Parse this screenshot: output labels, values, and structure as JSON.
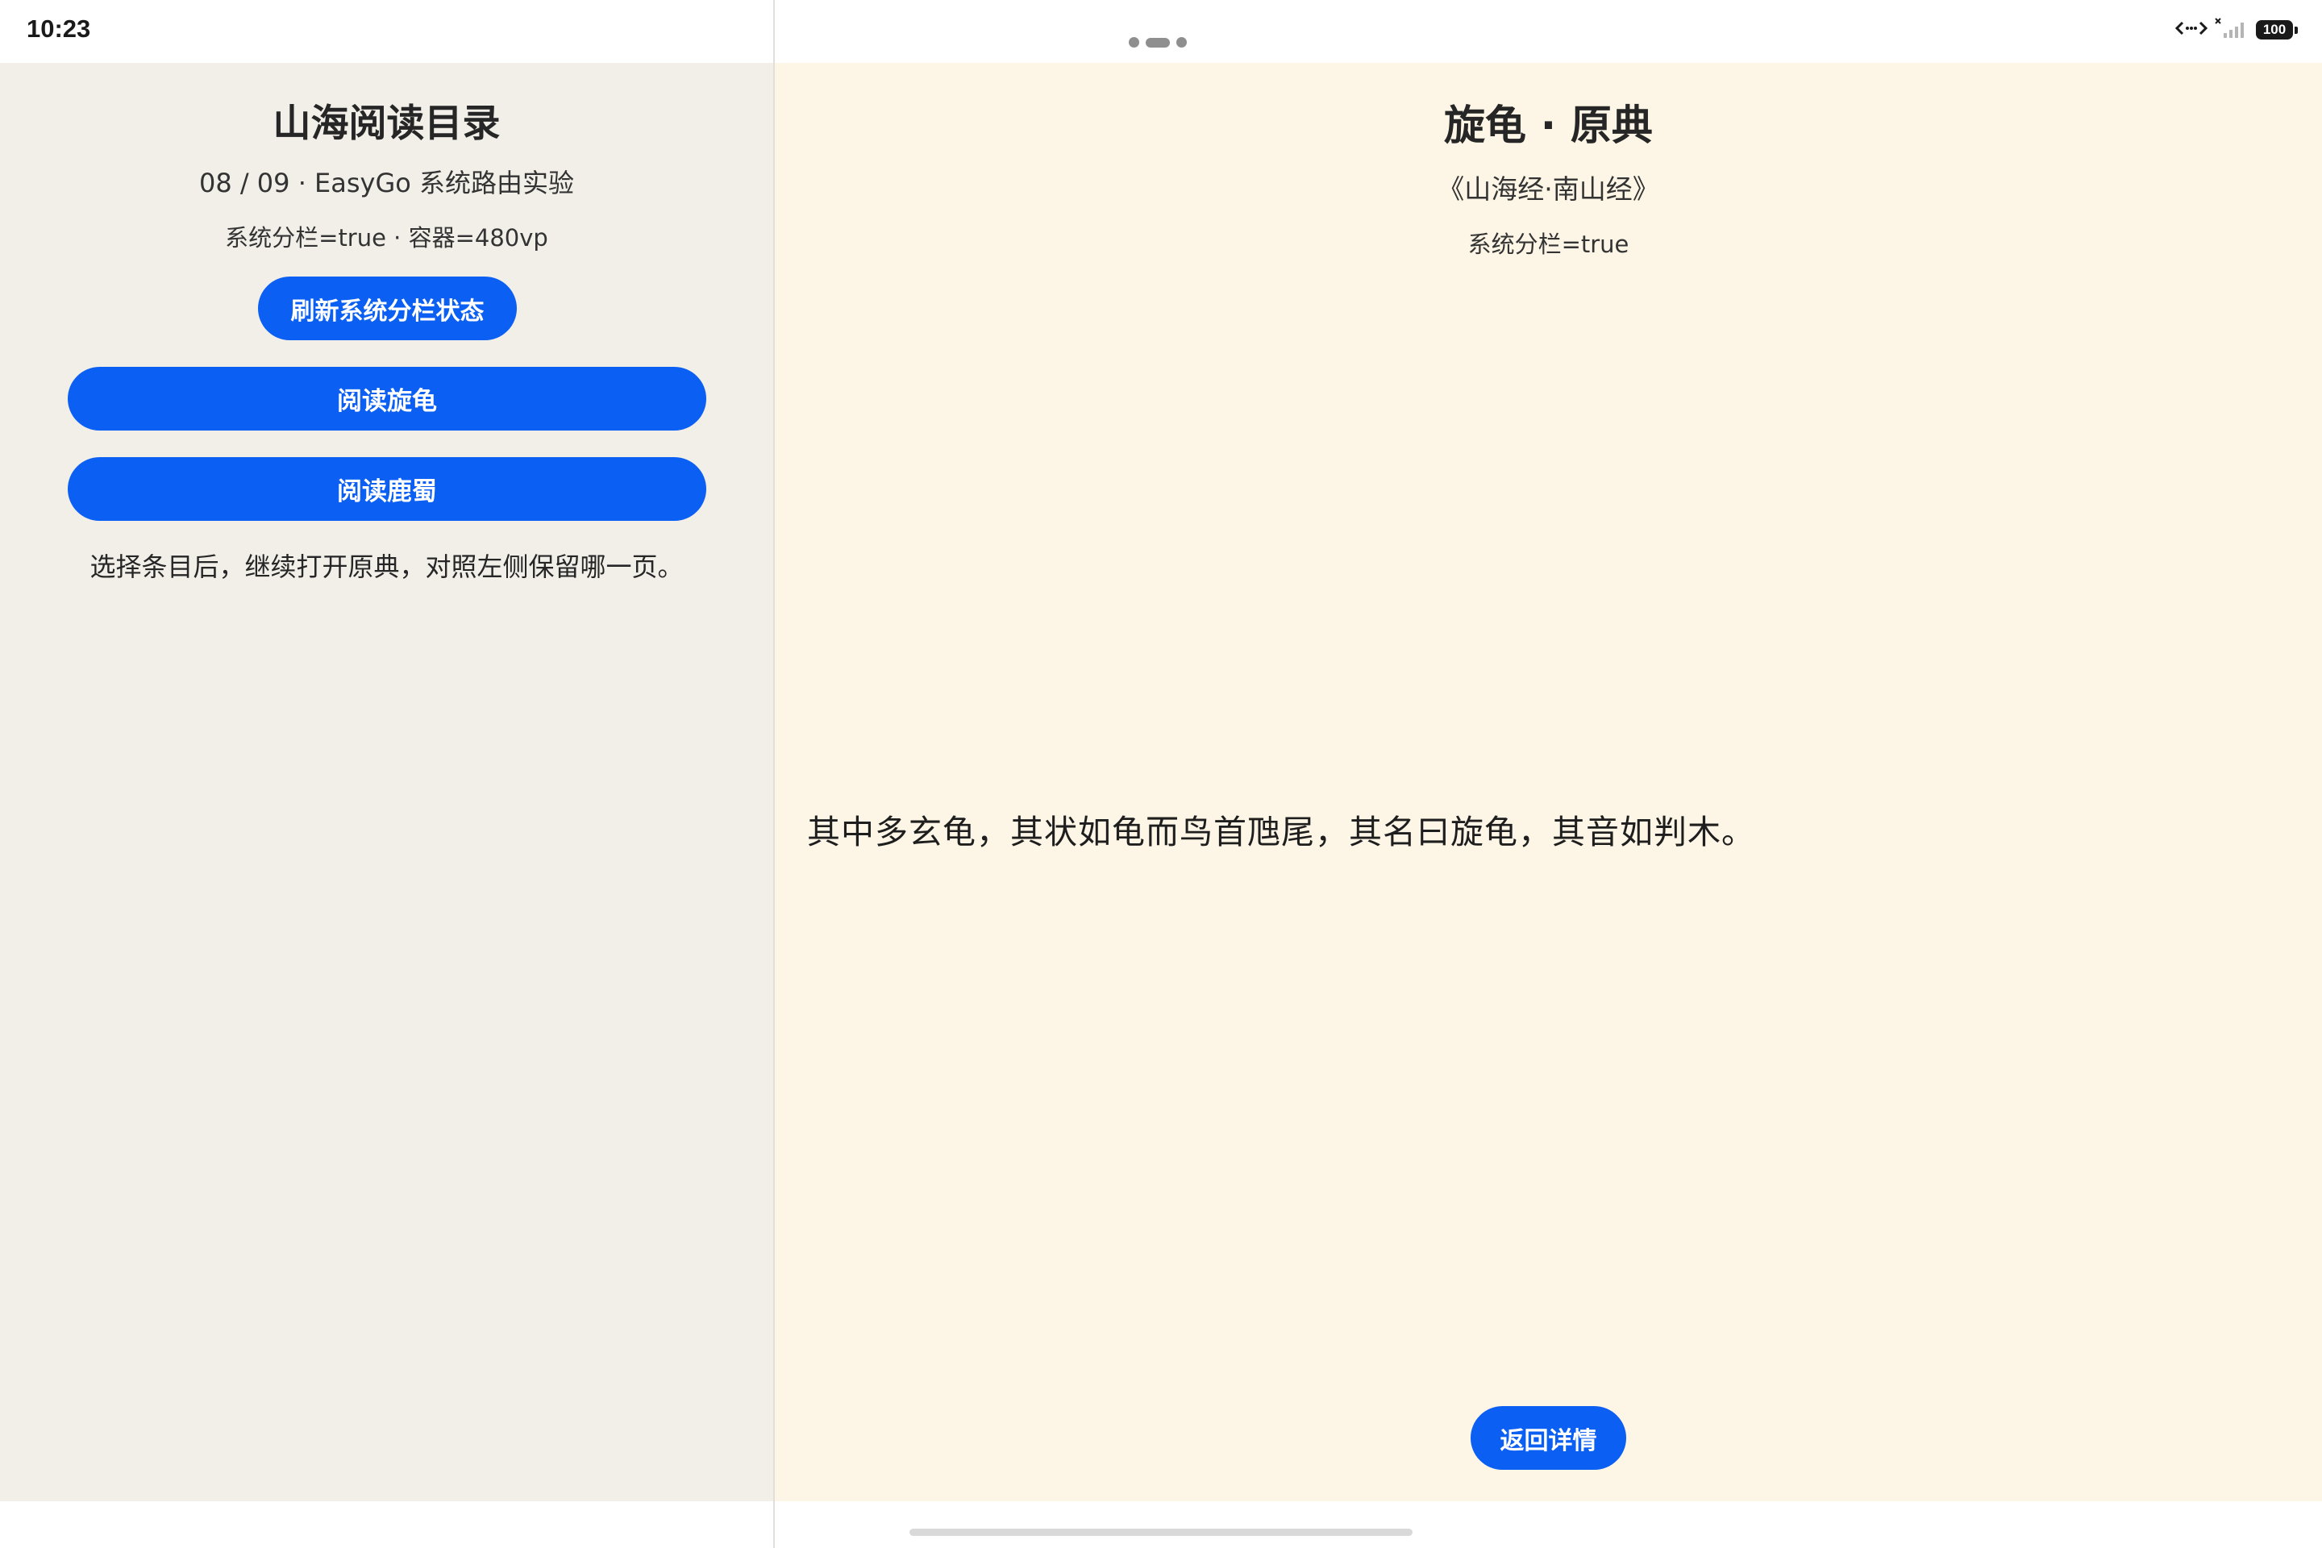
{
  "status_bar": {
    "time": "10:23",
    "battery_level": "100",
    "icons": [
      "network-transfer-icon",
      "no-sim-icon",
      "signal-icon",
      "battery-icon"
    ]
  },
  "left_pane": {
    "title": "山海阅读目录",
    "meta": "08 / 09 · EasyGo 系统路由实验",
    "status": "系统分栏=true · 容器=480vp",
    "refresh_button": "刷新系统分栏状态",
    "read_buttons": [
      "阅读旋龟",
      "阅读鹿蜀"
    ],
    "hint": "选择条目后，继续打开原典，对照左侧保留哪一页。"
  },
  "right_pane": {
    "title": "旋龟 · 原典",
    "source": "《山海经·南山经》",
    "status": "系统分栏=true",
    "body": "其中多玄龟，其状如龟而鸟首虺尾，其名曰旋龟，其音如判木。",
    "back_button": "返回详情"
  },
  "colors": {
    "accent": "#0b5ff2",
    "left_background": "#f2efe9",
    "right_background": "#fdf6e6"
  }
}
